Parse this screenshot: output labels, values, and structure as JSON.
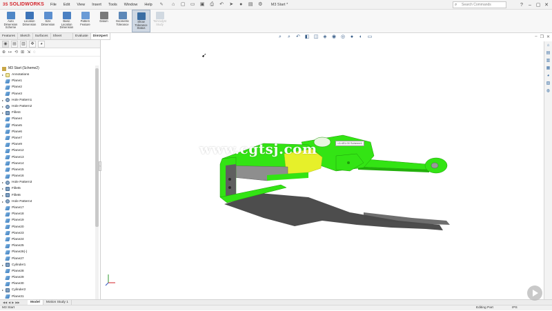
{
  "app": {
    "brand": "SOLIDWORKS",
    "brand_prefix": "3S",
    "document_title": "M3 Start *"
  },
  "menu": [
    "File",
    "Edit",
    "View",
    "Insert",
    "Tools",
    "Window",
    "Help"
  ],
  "search": {
    "placeholder": "Search Commands"
  },
  "ribbon": [
    {
      "label": "Auto\nDimension\nScheme",
      "color": "#4f87c6",
      "active": false,
      "disabled": false
    },
    {
      "label": "Location\nDimension",
      "color": "#3d74b8",
      "active": false,
      "disabled": false
    },
    {
      "label": "Size\nDimension",
      "color": "#5c8fcf",
      "active": false,
      "disabled": false
    },
    {
      "label": "Basic Location\nDimension",
      "color": "#4a80c2",
      "active": false,
      "disabled": false
    },
    {
      "label": "Pattern\nFeature",
      "color": "#6a9bd6",
      "active": false,
      "disabled": false
    },
    {
      "label": "Datum",
      "color": "#7a7a7a",
      "active": false,
      "disabled": false
    },
    {
      "label": "Geometric\nTolerance",
      "color": "#5d88b8",
      "active": false,
      "disabled": false
    },
    {
      "label": "Show\nTolerance\nStatus",
      "color": "#3a6da3",
      "active": true,
      "disabled": false
    },
    {
      "label": "TolAnalyst\nStudy",
      "color": "#8aa0b8",
      "active": false,
      "disabled": true
    }
  ],
  "command_tabs": [
    "Features",
    "Sketch",
    "Surfaces",
    "Sheet Metal",
    "Evaluate",
    "DimXpert"
  ],
  "active_command_tab": "DimXpert",
  "feature_tree": {
    "root": "M3 Start (Scheme2)",
    "items": [
      {
        "label": "Annotations",
        "type": "ann",
        "expand": true
      },
      {
        "label": "Plane1",
        "type": "plane",
        "expand": false
      },
      {
        "label": "Plane2",
        "type": "plane",
        "expand": false
      },
      {
        "label": "Plane3",
        "type": "plane",
        "expand": false
      },
      {
        "label": "Hole Pattern1",
        "type": "hole",
        "expand": true
      },
      {
        "label": "Hole Pattern2",
        "type": "hole",
        "expand": true
      },
      {
        "label": "Fillet4",
        "type": "feat",
        "expand": true
      },
      {
        "label": "Plane4",
        "type": "plane",
        "expand": false
      },
      {
        "label": "Plane5",
        "type": "plane",
        "expand": false
      },
      {
        "label": "Plane6",
        "type": "plane",
        "expand": false
      },
      {
        "label": "Plane7",
        "type": "plane",
        "expand": false
      },
      {
        "label": "Plane9",
        "type": "plane",
        "expand": false
      },
      {
        "label": "Plane12",
        "type": "plane",
        "expand": false
      },
      {
        "label": "Plane13",
        "type": "plane",
        "expand": false
      },
      {
        "label": "Plane14",
        "type": "plane",
        "expand": false
      },
      {
        "label": "Plane15",
        "type": "plane",
        "expand": false
      },
      {
        "label": "Plane16",
        "type": "plane",
        "expand": false
      },
      {
        "label": "Hole Pattern3",
        "type": "hole",
        "expand": true
      },
      {
        "label": "Fillet5",
        "type": "feat",
        "expand": true
      },
      {
        "label": "Fillet6",
        "type": "feat",
        "expand": true
      },
      {
        "label": "Hole Pattern4",
        "type": "hole",
        "expand": true
      },
      {
        "label": "Plane17",
        "type": "plane",
        "expand": false
      },
      {
        "label": "Plane18",
        "type": "plane",
        "expand": false
      },
      {
        "label": "Plane19",
        "type": "plane",
        "expand": false
      },
      {
        "label": "Plane20",
        "type": "plane",
        "expand": false
      },
      {
        "label": "Plane23",
        "type": "plane",
        "expand": false
      },
      {
        "label": "Plane24",
        "type": "plane",
        "expand": false
      },
      {
        "label": "Plane25",
        "type": "plane",
        "expand": false
      },
      {
        "label": "Plane26(-)",
        "type": "plane",
        "expand": false
      },
      {
        "label": "Plane27",
        "type": "plane",
        "expand": false
      },
      {
        "label": "Cylinder1",
        "type": "feat",
        "expand": true
      },
      {
        "label": "Plane28",
        "type": "plane",
        "expand": false
      },
      {
        "label": "Plane29",
        "type": "plane",
        "expand": false
      },
      {
        "label": "Plane30",
        "type": "plane",
        "expand": false
      },
      {
        "label": "Cylinder2",
        "type": "feat",
        "expand": true
      },
      {
        "label": "Plane31",
        "type": "plane",
        "expand": false
      }
    ]
  },
  "viewport": {
    "watermark": "www.cgtsj.com",
    "callout": "<1>Ø1.00 Scheme1",
    "colors": {
      "green": "#33e414",
      "yellow": "#e6f02a",
      "gray": "#8e8e8e",
      "dark_gray": "#5f5f5f",
      "shadow": "#3a3a3a"
    }
  },
  "bottom_tabs": [
    "Model",
    "Motion Study 1"
  ],
  "active_bottom_tab": "Model",
  "status": {
    "document": "M3 Start",
    "mode": "Editing Part",
    "units": "IPS"
  }
}
